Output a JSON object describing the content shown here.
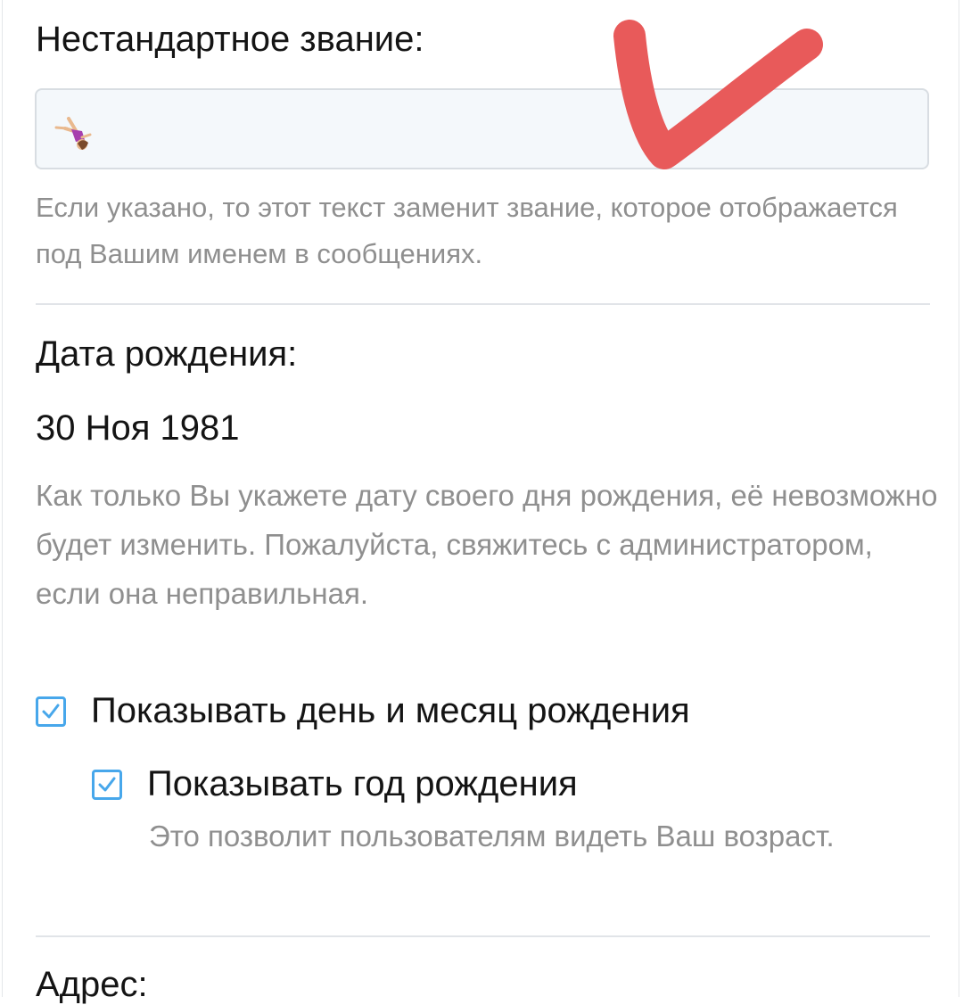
{
  "custom_title": {
    "label": "Нестандартное звание:",
    "input_value_icon": "person-doing-cartwheel-emoji",
    "hint": "Если указано, то этот текст заменит звание, которое отображается под Вашим именем в сообщениях."
  },
  "birthday": {
    "label": "Дата рождения:",
    "value": "30 Ноя 1981",
    "hint": "Как только Вы укажете дату своего дня рождения, её невозможно будет изменить. Пожалуйста, свяжитесь с администратором, если она неправильная."
  },
  "options": {
    "show_day_month": {
      "label": "Показывать день и месяц рождения",
      "checked": true
    },
    "show_year": {
      "label": "Показывать год рождения",
      "checked": true,
      "hint": "Это позволит пользователям видеть Ваш возраст."
    }
  },
  "address": {
    "label": "Адрес:"
  },
  "annotation": {
    "icon": "red-checkmark-drawing",
    "color": "#e85a5a"
  },
  "colors": {
    "accent": "#47a7eb",
    "hint_text": "#8f8f8f",
    "input_bg": "#f4f8fb"
  }
}
